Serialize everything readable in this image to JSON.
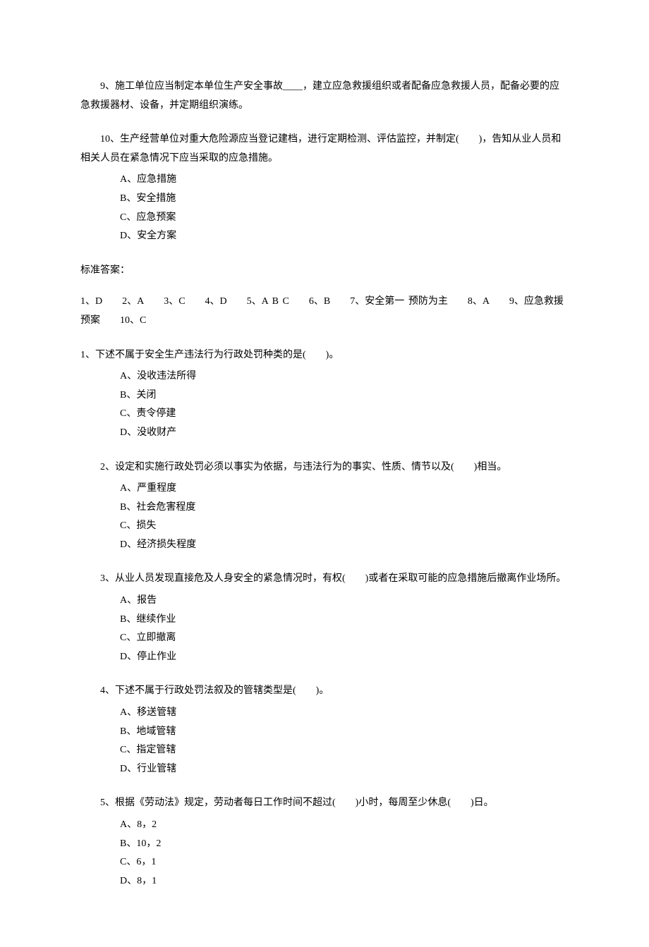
{
  "blockA": {
    "q9": "9、施工单位应当制定本单位生产安全事故____，建立应急救援组织或者配备应急救援人员，配备必要的应急救援器材、设备，并定期组织演练。",
    "q10": {
      "stem": "10、生产经营单位对重大危险源应当登记建档，进行定期检测、评估监控，并制定(  )，告知从业人员和相关人员在紧急情况下应当采取的应急措施。",
      "A": "A、应急措施",
      "B": "B、安全措施",
      "C": "C、应急预案",
      "D": "D、安全方案"
    },
    "answerLabel": "标准答案：",
    "answers": "1、D  2、A  3、C  4、D  5、A B C  6、B  7、安全第一 预防为主  8、A  9、应急救援预案  10、C"
  },
  "blockB": {
    "q1": {
      "stem": "1、下述不属于安全生产违法行为行政处罚种类的是(  )。",
      "A": "A、没收违法所得",
      "B": "B、关闭",
      "C": "C、责令停建",
      "D": "D、没收财产"
    },
    "q2": {
      "stem": "2、设定和实施行政处罚必须以事实为依据，与违法行为的事实、性质、情节以及(  )相当。",
      "A": "A、严重程度",
      "B": "B、社会危害程度",
      "C": "C、损失",
      "D": "D、经济损失程度"
    },
    "q3": {
      "stem": "3、从业人员发现直接危及人身安全的紧急情况时，有权(  )或者在采取可能的应急措施后撤离作业场所。",
      "A": "A、报告",
      "B": "B、继续作业",
      "C": "C、立即撤离",
      "D": "D、停止作业"
    },
    "q4": {
      "stem": "4、下述不属于行政处罚法叙及的管辖类型是(  )。",
      "A": "A、移送管辖",
      "B": "B、地域管辖",
      "C": "C、指定管辖",
      "D": "D、行业管辖"
    },
    "q5": {
      "stem": "5、根据《劳动法》规定，劳动者每日工作时间不超过(  )小时，每周至少休息(  )日。",
      "A": "A、8，2",
      "B": "B、10，2",
      "C": "C、6，1",
      "D": "D、8，1"
    }
  }
}
